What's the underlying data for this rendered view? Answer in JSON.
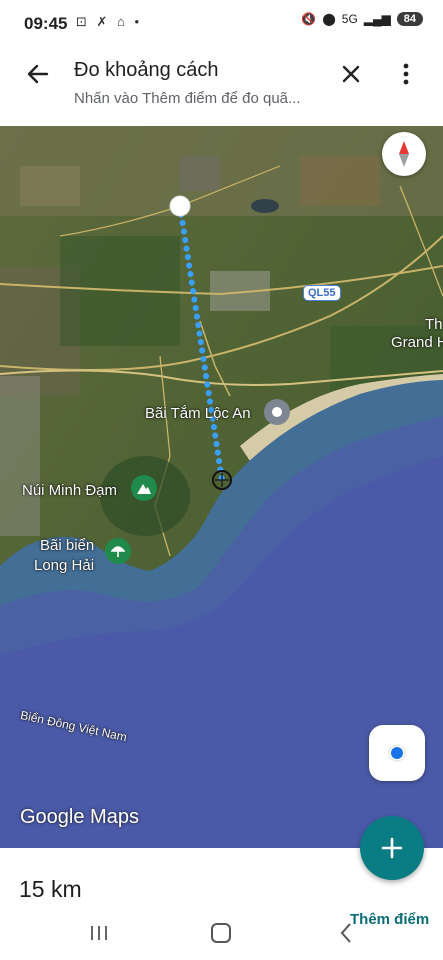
{
  "status_bar": {
    "time": "09:45",
    "left_icons": "⊡ ✗ ⌂ •",
    "battery": "84",
    "network": "5G"
  },
  "app_bar": {
    "title": "Đo khoảng cách",
    "subtitle": "Nhấn vào Thêm điểm để đo quã..."
  },
  "map": {
    "labels": {
      "loc_an": "Bãi Tắm Lộc An",
      "minh_dam": "Núi Minh Đạm",
      "long_hai_1": "Bãi biển",
      "long_hai_2": "Long Hải",
      "bien_dong": "Biển Đông Việt Nam",
      "grand_1": "Th",
      "grand_2": "Grand H",
      "road": "QL55"
    },
    "brand": "Google Maps",
    "colors": {
      "measure_line": "#3aa0ff",
      "sea": "#4a5aa8",
      "fab": "#0a7c84"
    }
  },
  "bottom": {
    "distance": "15 km",
    "add_point": "Thêm điểm"
  }
}
